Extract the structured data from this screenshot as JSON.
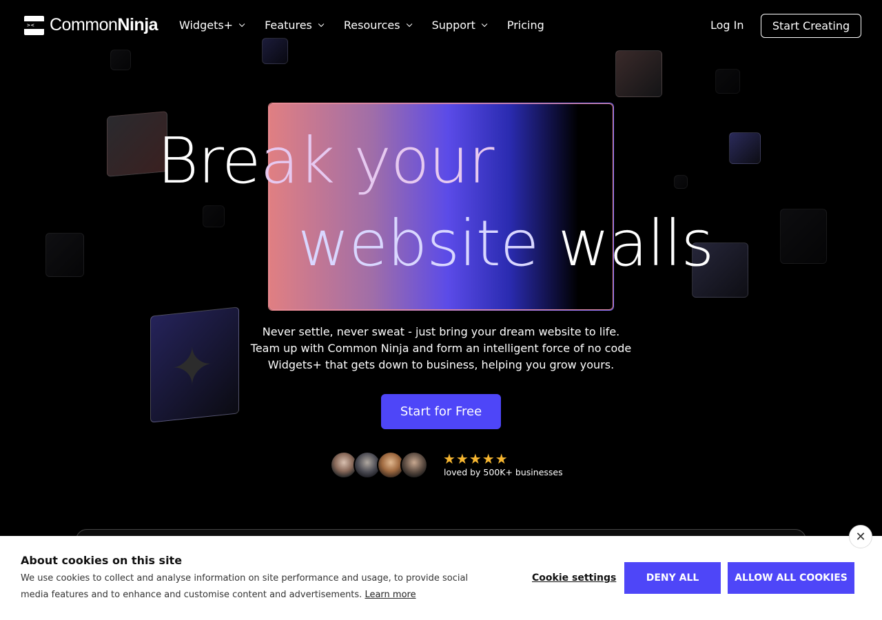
{
  "nav": {
    "logo_common": "Common",
    "logo_ninja": "Ninja",
    "items": [
      {
        "label": "Widgets+",
        "has_dropdown": true
      },
      {
        "label": "Features",
        "has_dropdown": true
      },
      {
        "label": "Resources",
        "has_dropdown": true
      },
      {
        "label": "Support",
        "has_dropdown": true
      },
      {
        "label": "Pricing",
        "has_dropdown": false
      }
    ],
    "login": "Log In",
    "start_creating": "Start Creating"
  },
  "hero": {
    "line1_a": "Bre",
    "line1_b": "ak your",
    "line2_a": "website",
    "line2_b": " walls",
    "sub1": "Never settle, never sweat - just bring your dream website to life.",
    "sub2": "Team up with Common Ninja and form an intelligent force of no code",
    "sub3": "Widgets+ that gets down to business, helping you grow yours.",
    "cta": "Start for Free",
    "stars": "★★★★★",
    "rating": 5,
    "loved": "loved by 500K+ businesses"
  },
  "cookie": {
    "title": "About cookies on this site",
    "text": "We use cookies to collect and analyse information on site performance and usage, to provide social media features and to enhance and customise content and advertisements.",
    "learn_more": "Learn more",
    "settings": "Cookie settings",
    "deny": "DENY ALL",
    "allow": "ALLOW ALL COOKIES",
    "close": "✕"
  },
  "colors": {
    "accent": "#4e46f8",
    "star": "#f7b630"
  }
}
